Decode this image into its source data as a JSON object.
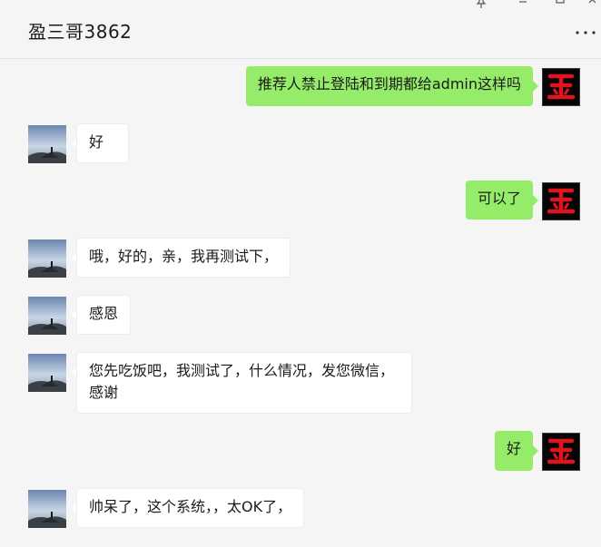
{
  "window": {
    "title": "盈三哥3862",
    "pin_icon": "pin-icon",
    "minimize_icon": "minimize-icon",
    "maximize_icon": "maximize-icon",
    "close_icon": "close-icon",
    "more_icon": "more-dots-icon"
  },
  "messages": [
    {
      "from": "me",
      "text": "推荐人禁止登陆和到期都给admin这样吗"
    },
    {
      "from": "other",
      "text": "好"
    },
    {
      "from": "me",
      "text": "可以了"
    },
    {
      "from": "other",
      "text": "哦，好的，亲，我再测试下，"
    },
    {
      "from": "other",
      "text": "感恩"
    },
    {
      "from": "other",
      "text": "您先吃饭吧，我测试了，什么情况，发您微信，感谢"
    },
    {
      "from": "me",
      "text": "好"
    },
    {
      "from": "other",
      "text": "帅呆了，这个系统，，太OK了，"
    }
  ],
  "colors": {
    "my_bubble": "#95ec69",
    "other_bubble": "#ffffff",
    "background": "#f5f5f5",
    "my_avatar_glyph": "#e0141e"
  }
}
